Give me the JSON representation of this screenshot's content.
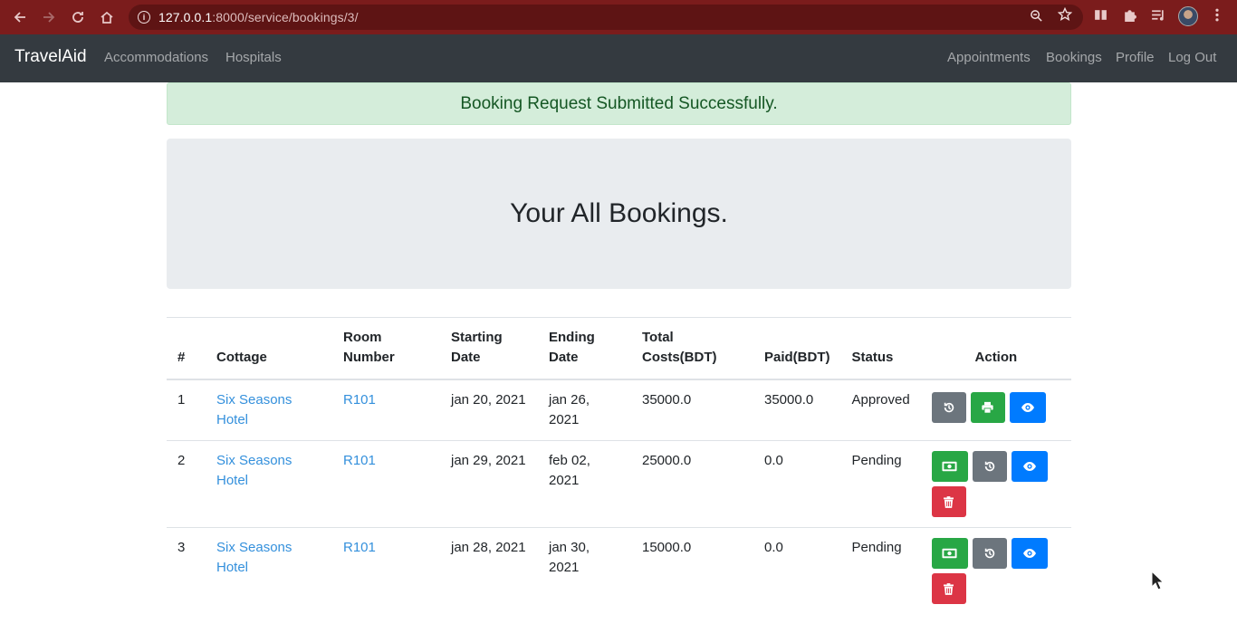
{
  "browser": {
    "url_host": "127.0.0.1",
    "url_rest": ":8000/service/bookings/3/"
  },
  "navbar": {
    "brand": "TravelAid",
    "left_links": [
      "Accommodations",
      "Hospitals"
    ],
    "right_links": [
      "Appointments",
      "Bookings",
      "Profile",
      "Log Out"
    ]
  },
  "alert": {
    "message": "Booking Request Submitted Successfully."
  },
  "jumbotron": {
    "title": "Your All Bookings."
  },
  "table": {
    "headers": {
      "num": "#",
      "cottage": "Cottage",
      "room_1": "Room",
      "room_2": "Number",
      "start_1": "Starting",
      "start_2": "Date",
      "end_1": "Ending",
      "end_2": "Date",
      "total_1": "Total",
      "total_2": "Costs(BDT)",
      "paid": "Paid(BDT)",
      "status": "Status",
      "action": "Action"
    },
    "rows": [
      {
        "num": "1",
        "cottage_1": "Six Seasons",
        "cottage_2": "Hotel",
        "room": "R101",
        "start": "jan 20, 2021",
        "end_1": "jan 26,",
        "end_2": "2021",
        "total": "35000.0",
        "paid": "35000.0",
        "status": "Approved",
        "actions": [
          "history",
          "print",
          "view"
        ]
      },
      {
        "num": "2",
        "cottage_1": "Six Seasons",
        "cottage_2": "Hotel",
        "room": "R101",
        "start": "jan 29, 2021",
        "end_1": "feb 02,",
        "end_2": "2021",
        "total": "25000.0",
        "paid": "0.0",
        "status": "Pending",
        "actions": [
          "pay",
          "history",
          "view",
          "delete"
        ]
      },
      {
        "num": "3",
        "cottage_1": "Six Seasons",
        "cottage_2": "Hotel",
        "room": "R101",
        "start": "jan 28, 2021",
        "end_1": "jan 30,",
        "end_2": "2021",
        "total": "15000.0",
        "paid": "0.0",
        "status": "Pending",
        "actions": [
          "pay",
          "history",
          "view",
          "delete"
        ]
      }
    ]
  },
  "colors": {
    "chrome": "#7b1c1c",
    "navbar": "#343a40",
    "alert_bg": "#d4edda",
    "alert_text": "#155724",
    "link": "#3490dc",
    "secondary": "#6c757d",
    "success": "#28a745",
    "primary": "#007bff",
    "danger": "#dc3545"
  }
}
